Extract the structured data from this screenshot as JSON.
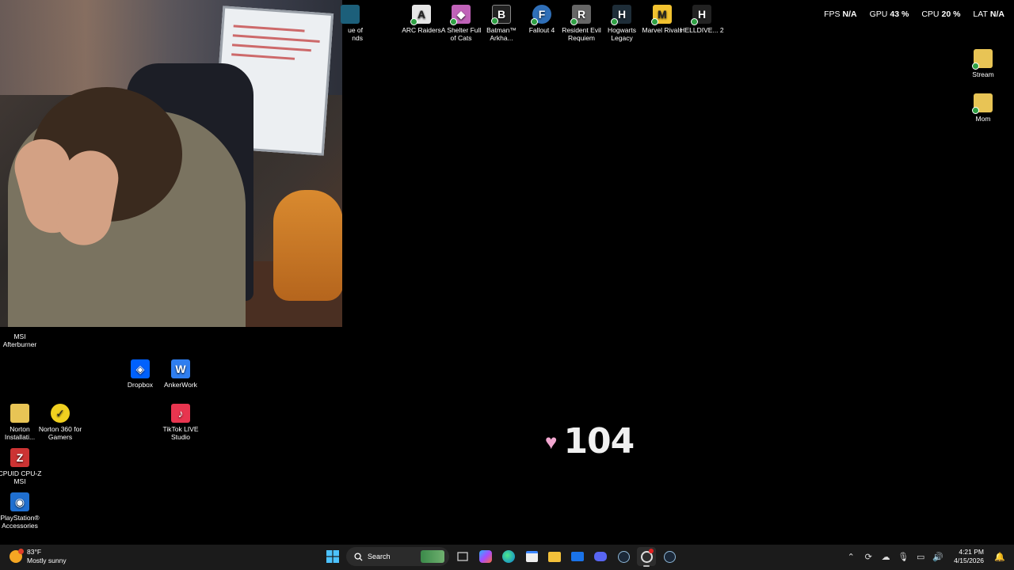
{
  "overlay_stats": [
    {
      "label": "FPS",
      "value": "N/A"
    },
    {
      "label": "GPU",
      "value": "43 %"
    },
    {
      "label": "CPU",
      "value": "20 %"
    },
    {
      "label": "LAT",
      "value": "N/A"
    }
  ],
  "top_icons": [
    {
      "label": "ue of\nnds",
      "glyph": "L",
      "color": "#1c5f7a"
    },
    {
      "label": "ARC Raiders",
      "glyph": "A",
      "color": "#e6e6e6"
    },
    {
      "label": "A Shelter Full of Cats",
      "glyph": "🐱",
      "color": "#c062b8"
    },
    {
      "label": "Batman™ Arkha...",
      "glyph": "B",
      "color": "#222"
    },
    {
      "label": "Fallout 4",
      "glyph": "F",
      "color": "#2f6fb8"
    },
    {
      "label": "Resident Evil Requiem",
      "glyph": "R",
      "color": "#555"
    },
    {
      "label": "Hogwarts Legacy",
      "glyph": "H",
      "color": "#1e2d38"
    },
    {
      "label": "Marvel Rivals",
      "glyph": "M",
      "color": "#f2c230"
    },
    {
      "label": "HELLDIVE... 2",
      "glyph": "H",
      "color": "#222"
    }
  ],
  "right_icons": [
    {
      "label": "Stream",
      "glyph": "📁",
      "color": "#e8c455"
    },
    {
      "label": "Mom",
      "glyph": "📁",
      "color": "#e8c455"
    }
  ],
  "left_icons": [
    {
      "label": "MSI Afterburner",
      "glyph": "M",
      "color": "#7a1a1a"
    },
    {
      "label": "Dropbox",
      "glyph": "⬙",
      "color": "#0061fe"
    },
    {
      "label": "AnkerWork",
      "glyph": "W",
      "color": "#2f7ef0"
    },
    {
      "label": "Norton Installati...",
      "glyph": "📁",
      "color": "#e8c455"
    },
    {
      "label": "Norton 360 for Gamers",
      "glyph": "✓",
      "color": "#f0d020"
    },
    {
      "label": "TikTok LIVE Studio",
      "glyph": "♪",
      "color": "#e8354f"
    },
    {
      "label": "CPUID CPU-Z MSI",
      "glyph": "Z",
      "color": "#c33"
    },
    {
      "label": "PlayStation® Accessories",
      "glyph": "🎮",
      "color": "#1f6fd0"
    }
  ],
  "heart_counter": {
    "icon": "heart-icon",
    "value": "104"
  },
  "weather": {
    "temp": "83°F",
    "condition": "Mostly sunny"
  },
  "taskbar": {
    "search_label": "Search"
  },
  "clock": {
    "time": "4:21 PM",
    "date": "4/15/2026"
  }
}
